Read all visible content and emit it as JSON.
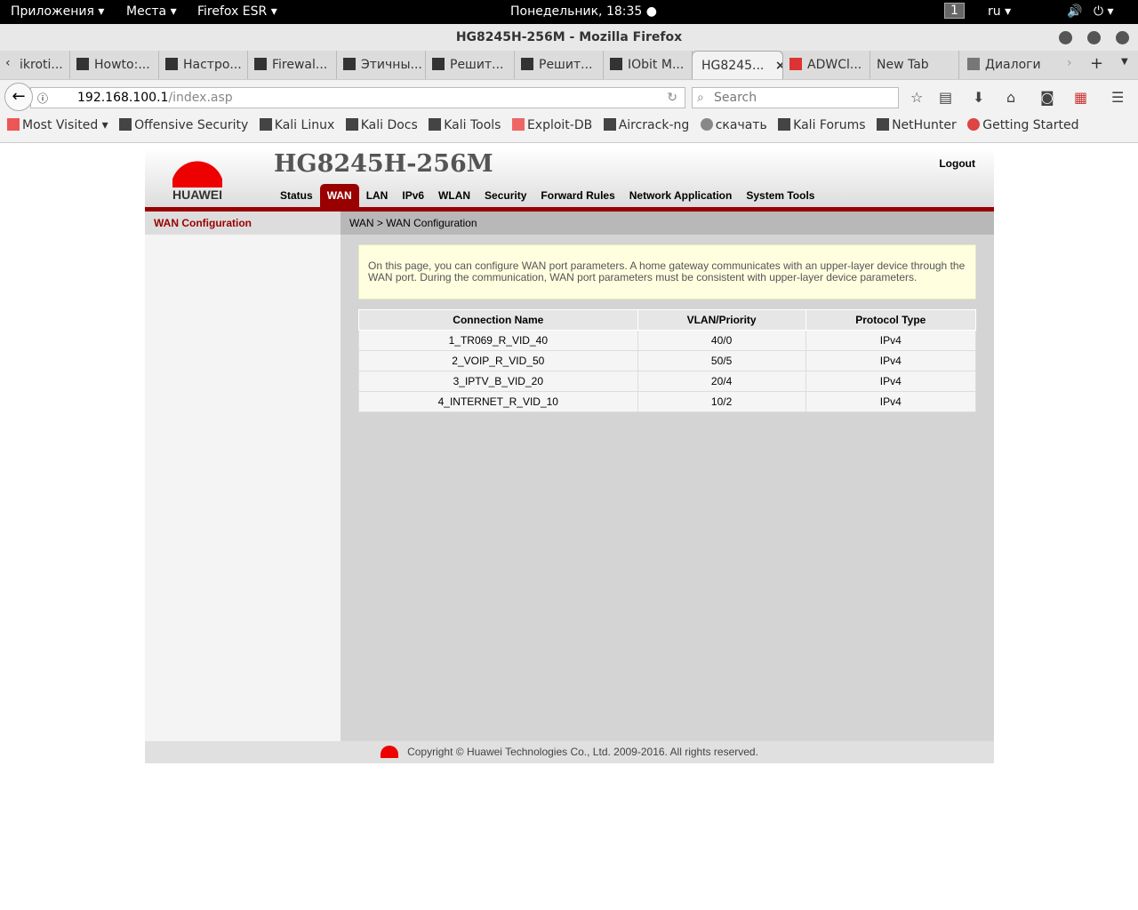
{
  "system": {
    "apps": "Приложения ▾",
    "places": "Места ▾",
    "browser": "Firefox ESR ▾",
    "clock": "Понедельник, 18:35 ●",
    "workspace": "1",
    "lang": "ru ▾"
  },
  "window": {
    "title": "HG8245H-256M - Mozilla Firefox"
  },
  "tabs": [
    "ikroti...",
    "Howto:...",
    "Настро...",
    "Firewal...",
    "Этичны...",
    "Решит...",
    "Решит...",
    "IObit M...",
    "HG8245...",
    "ADWCl...",
    "New Tab",
    "Диалоги"
  ],
  "nav": {
    "url_host": "192.168.100.1",
    "url_path": "/index.asp",
    "search_placeholder": "Search"
  },
  "bookmarks": [
    "Most Visited ▾",
    "Offensive Security",
    "Kali Linux",
    "Kali Docs",
    "Kali Tools",
    "Exploit-DB",
    "Aircrack-ng",
    "скачать",
    "Kali Forums",
    "NetHunter",
    "Getting Started"
  ],
  "router": {
    "brand": "HUAWEI",
    "model": "HG8245H-256M",
    "logout": "Logout",
    "menu": [
      "Status",
      "WAN",
      "LAN",
      "IPv6",
      "WLAN",
      "Security",
      "Forward Rules",
      "Network Application",
      "System Tools"
    ],
    "side_title": "WAN Configuration",
    "breadcrumb": "WAN > WAN Configuration",
    "note": "On this page, you can configure WAN port parameters. A home gateway communicates with an upper-layer device through the WAN port. During the communication, WAN port parameters must be consistent with upper-layer device parameters.",
    "columns": [
      "Connection Name",
      "VLAN/Priority",
      "Protocol Type"
    ],
    "rows": [
      [
        "1_TR069_R_VID_40",
        "40/0",
        "IPv4"
      ],
      [
        "2_VOIP_R_VID_50",
        "50/5",
        "IPv4"
      ],
      [
        "3_IPTV_B_VID_20",
        "20/4",
        "IPv4"
      ],
      [
        "4_INTERNET_R_VID_10",
        "10/2",
        "IPv4"
      ]
    ],
    "footer": "Copyright © Huawei Technologies Co., Ltd. 2009-2016. All rights reserved."
  }
}
